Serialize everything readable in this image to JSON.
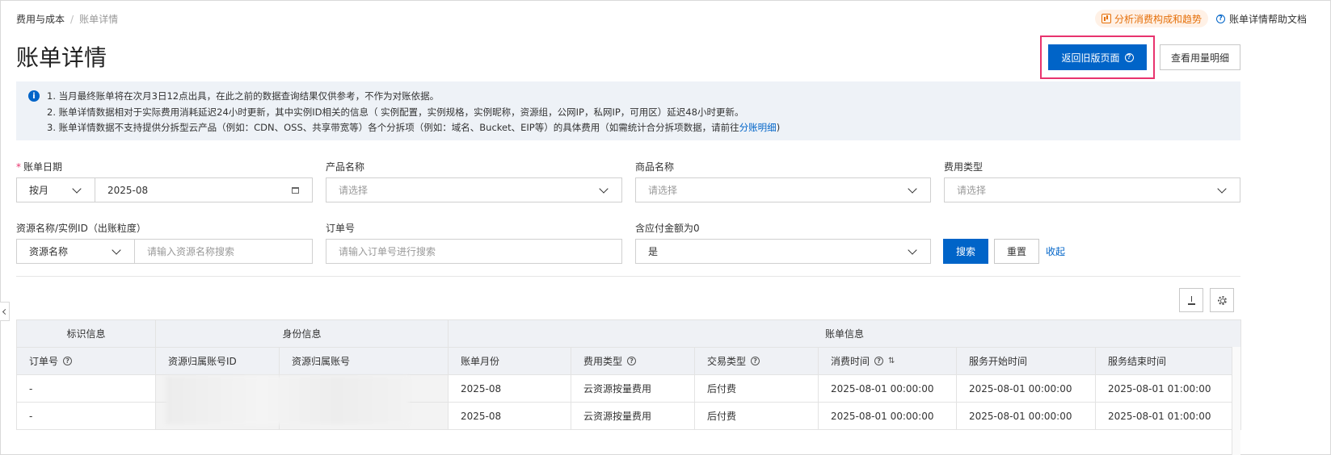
{
  "breadcrumb": {
    "root": "费用与成本",
    "sep": "/",
    "current": "账单详情"
  },
  "top_links": {
    "analyze": "分析消费构成和趋势",
    "help": "账单详情帮助文档"
  },
  "page_title": "账单详情",
  "header_buttons": {
    "old_version": "返回旧版页面",
    "usage_detail": "查看用量明细"
  },
  "notice": {
    "line1": "1. 当月最终账单将在次月3日12点出具，在此之前的数据查询结果仅供参考，不作为对账依据。",
    "line2": "2. 账单详情数据相对于实际费用消耗延迟24小时更新，其中实例ID相关的信息（ 实例配置，实例规格，实例昵称，资源组，公网IP，私网IP，可用区）延迟48小时更新。",
    "line3_prefix": "3. 账单详情数据不支持提供分拆型云产品（例如：CDN、OSS、共享带宽等）各个分拆项（例如：域名、Bucket、EIP等）的具体费用（如需统计合分拆项数据，请前往",
    "line3_link": "分账明细",
    "line3_suffix": ")"
  },
  "filters": {
    "bill_date": {
      "label": "账单日期",
      "mode": "按月",
      "value": "2025-08"
    },
    "product_name": {
      "label": "产品名称",
      "placeholder": "请选择"
    },
    "commodity_name": {
      "label": "商品名称",
      "placeholder": "请选择"
    },
    "cost_type": {
      "label": "费用类型",
      "placeholder": "请选择"
    },
    "resource": {
      "label": "资源名称/实例ID（出账粒度）",
      "mode": "资源名称",
      "placeholder": "请输入资源名称搜索"
    },
    "order_no": {
      "label": "订单号",
      "placeholder": "请输入订单号进行搜索"
    },
    "zero_amount": {
      "label": "含应付金额为0",
      "value": "是"
    },
    "search": "搜索",
    "reset": "重置",
    "collapse": "收起"
  },
  "table": {
    "groups": [
      "标识信息",
      "身份信息",
      "账单信息"
    ],
    "columns": [
      "订单号",
      "资源归属账号ID",
      "资源归属账号",
      "账单月份",
      "费用类型",
      "交易类型",
      "消费时间",
      "服务开始时间",
      "服务结束时间"
    ],
    "rows": [
      [
        "-",
        "",
        "",
        "2025-08",
        "云资源按量费用",
        "后付费",
        "2025-08-01 00:00:00",
        "2025-08-01 00:00:00",
        "2025-08-01 01:00:00"
      ],
      [
        "-",
        "",
        "",
        "2025-08",
        "云资源按量费用",
        "后付费",
        "2025-08-01 00:00:00",
        "2025-08-01 00:00:00",
        "2025-08-01 01:00:00"
      ]
    ]
  },
  "colors": {
    "primary": "#0064c8",
    "highlight_border": "#e8336e",
    "notice_bg": "#eef2f7",
    "analyze_orange": "#e5700a"
  },
  "icons": [
    "info-icon",
    "help-icon",
    "chart-icon",
    "calendar-icon",
    "chevron-down-icon",
    "download-icon",
    "settings-gear-icon",
    "sort-icon",
    "collapse-arrow-icon"
  ]
}
